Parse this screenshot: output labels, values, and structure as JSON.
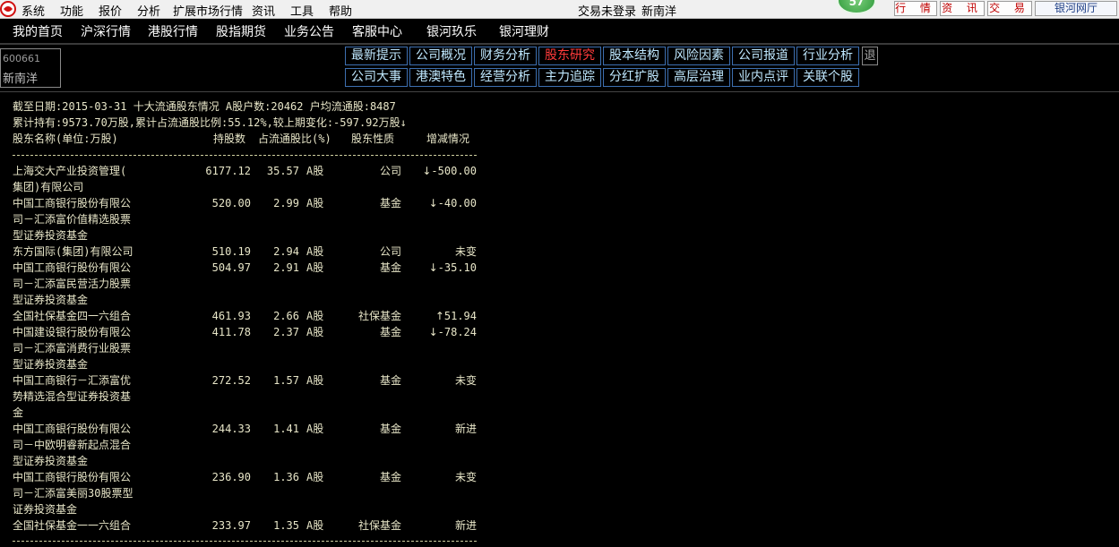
{
  "menu": [
    "系统",
    "功能",
    "报价",
    "分析",
    "扩展市场行情",
    "资讯",
    "工具",
    "帮助"
  ],
  "status": {
    "login_text": "交易未登录",
    "broker_name": "新南洋"
  },
  "badge": "57",
  "top_buttons": [
    "行 情",
    "资 讯",
    "交 易",
    "银河网厅"
  ],
  "nav": [
    "我的首页",
    "沪深行情",
    "港股行情",
    "股指期货",
    "业务公告",
    "客服中心",
    "银河玖乐",
    "银河理财"
  ],
  "stock": {
    "code": "600661",
    "name": "新南洋"
  },
  "tabs_row1": [
    "最新提示",
    "公司概况",
    "财务分析",
    "股东研究",
    "股本结构",
    "风险因素",
    "公司报道",
    "行业分析"
  ],
  "tabs_row2": [
    "公司大事",
    "港澳特色",
    "经营分析",
    "主力追踪",
    "分红扩股",
    "高层治理",
    "业内点评",
    "关联个股"
  ],
  "active_tab": "股东研究",
  "exit_label": "退",
  "report": {
    "line1": "截至日期:2015-03-31 十大流通股东情况 A股户数:20462 户均流通股:8487",
    "line2": "累计持有:9573.70万股,累计占流通股比例:55.12%,较上期变化:-597.92万股↓",
    "headers": {
      "name": "股东名称(单位:万股)",
      "hold": "持股数",
      "pct": "占流通股比(%)",
      "type": "股东性质",
      "chg": "增减情况"
    },
    "rows": [
      {
        "name": "上海交大产业投资管理(\n集团)有限公司",
        "hold": "6177.12",
        "pct": "35.57",
        "cls": "A股",
        "type": "公司",
        "arrow": "↓",
        "chg": "-500.00"
      },
      {
        "name": "中国工商银行股份有限公\n司－汇添富价值精选股票\n型证券投资基金",
        "hold": "520.00",
        "pct": "2.99",
        "cls": "A股",
        "type": "基金",
        "arrow": "↓",
        "chg": "-40.00"
      },
      {
        "name": "东方国际(集团)有限公司",
        "hold": "510.19",
        "pct": "2.94",
        "cls": "A股",
        "type": "公司",
        "arrow": "",
        "chg": "未变"
      },
      {
        "name": "中国工商银行股份有限公\n司－汇添富民营活力股票\n型证券投资基金",
        "hold": "504.97",
        "pct": "2.91",
        "cls": "A股",
        "type": "基金",
        "arrow": "↓",
        "chg": "-35.10"
      },
      {
        "name": "全国社保基金四一六组合",
        "hold": "461.93",
        "pct": "2.66",
        "cls": "A股",
        "type": "社保基金",
        "arrow": "↑",
        "chg": "51.94"
      },
      {
        "name": "中国建设银行股份有限公\n司－汇添富消费行业股票\n型证券投资基金",
        "hold": "411.78",
        "pct": "2.37",
        "cls": "A股",
        "type": "基金",
        "arrow": "↓",
        "chg": "-78.24"
      },
      {
        "name": "中国工商银行－汇添富优\n势精选混合型证券投资基\n金",
        "hold": "272.52",
        "pct": "1.57",
        "cls": "A股",
        "type": "基金",
        "arrow": "",
        "chg": "未变"
      },
      {
        "name": "中国工商银行股份有限公\n司－中欧明睿新起点混合\n型证券投资基金",
        "hold": "244.33",
        "pct": "1.41",
        "cls": "A股",
        "type": "基金",
        "arrow": "",
        "chg": "新进"
      },
      {
        "name": "中国工商银行股份有限公\n司－汇添富美丽30股票型\n证券投资基金",
        "hold": "236.90",
        "pct": "1.36",
        "cls": "A股",
        "type": "基金",
        "arrow": "",
        "chg": "未变"
      },
      {
        "name": "全国社保基金一一六组合",
        "hold": "233.97",
        "pct": "1.35",
        "cls": "A股",
        "type": "社保基金",
        "arrow": "",
        "chg": "新进"
      }
    ]
  }
}
